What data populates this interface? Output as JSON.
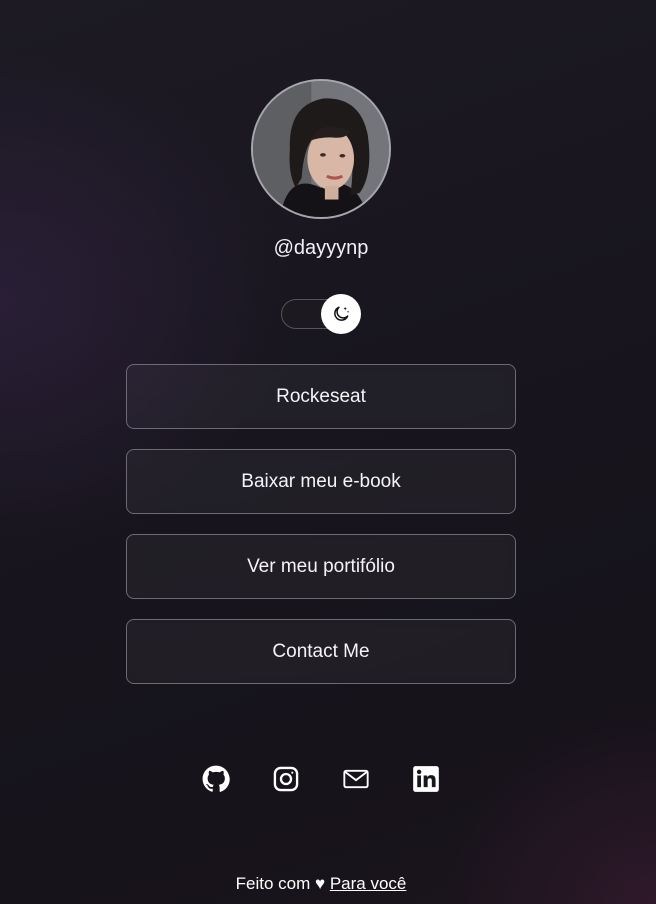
{
  "profile": {
    "handle": "@dayyynp",
    "avatar_alt": "profile photo"
  },
  "theme_toggle": {
    "icon": "moon-sparkle-icon",
    "state": "dark"
  },
  "links": [
    {
      "label": "Rockeseat"
    },
    {
      "label": "Baixar meu e-book"
    },
    {
      "label": "Ver meu portifólio"
    },
    {
      "label": "Contact Me"
    }
  ],
  "social": [
    {
      "icon": "github-icon"
    },
    {
      "icon": "instagram-icon"
    },
    {
      "icon": "mail-icon"
    },
    {
      "icon": "linkedin-icon"
    }
  ],
  "footer": {
    "made_with": "Feito com",
    "heart": "♥",
    "link_label": "Para você"
  },
  "colors": {
    "background": "#18151e",
    "button_border": "#6c6a73",
    "text": "#ffffff"
  }
}
